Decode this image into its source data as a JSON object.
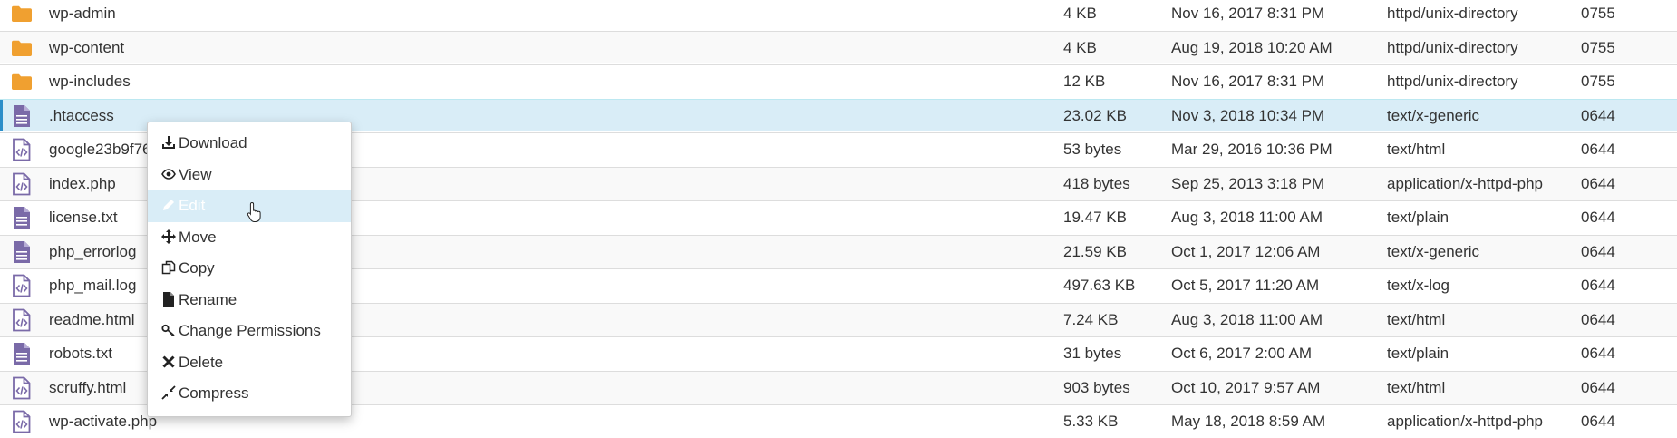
{
  "files": [
    {
      "name": "wp-admin",
      "size": "4 KB",
      "date": "Nov 16, 2017 8:31 PM",
      "type": "httpd/unix-directory",
      "perms": "0755",
      "icon": "folder-icon"
    },
    {
      "name": "wp-content",
      "size": "4 KB",
      "date": "Aug 19, 2018 10:20 AM",
      "type": "httpd/unix-directory",
      "perms": "0755",
      "icon": "folder-icon"
    },
    {
      "name": "wp-includes",
      "size": "12 KB",
      "date": "Nov 16, 2017 8:31 PM",
      "type": "httpd/unix-directory",
      "perms": "0755",
      "icon": "folder-icon"
    },
    {
      "name": ".htaccess",
      "size": "23.02 KB",
      "date": "Nov 3, 2018 10:34 PM",
      "type": "text/x-generic",
      "perms": "0644",
      "icon": "text-file-icon",
      "selected": true
    },
    {
      "name": "google23b9f76",
      "size": "53 bytes",
      "date": "Mar 29, 2016 10:36 PM",
      "type": "text/html",
      "perms": "0644",
      "icon": "code-file-icon"
    },
    {
      "name": "index.php",
      "size": "418 bytes",
      "date": "Sep 25, 2013 3:18 PM",
      "type": "application/x-httpd-php",
      "perms": "0644",
      "icon": "code-file-icon"
    },
    {
      "name": "license.txt",
      "size": "19.47 KB",
      "date": "Aug 3, 2018 11:00 AM",
      "type": "text/plain",
      "perms": "0644",
      "icon": "text-file-icon"
    },
    {
      "name": "php_errorlog",
      "size": "21.59 KB",
      "date": "Oct 1, 2017 12:06 AM",
      "type": "text/x-generic",
      "perms": "0644",
      "icon": "text-file-icon"
    },
    {
      "name": "php_mail.log",
      "size": "497.63 KB",
      "date": "Oct 5, 2017 11:20 AM",
      "type": "text/x-log",
      "perms": "0644",
      "icon": "code-file-icon"
    },
    {
      "name": "readme.html",
      "size": "7.24 KB",
      "date": "Aug 3, 2018 11:00 AM",
      "type": "text/html",
      "perms": "0644",
      "icon": "code-file-icon"
    },
    {
      "name": "robots.txt",
      "size": "31 bytes",
      "date": "Oct 6, 2017 2:00 AM",
      "type": "text/plain",
      "perms": "0644",
      "icon": "text-file-icon"
    },
    {
      "name": "scruffy.html",
      "size": "903 bytes",
      "date": "Oct 10, 2017 9:57 AM",
      "type": "text/html",
      "perms": "0644",
      "icon": "code-file-icon"
    },
    {
      "name": "wp-activate.php",
      "size": "5.33 KB",
      "date": "May 18, 2018 8:59 AM",
      "type": "application/x-httpd-php",
      "perms": "0644",
      "icon": "code-file-icon"
    }
  ],
  "context_menu": {
    "items": [
      {
        "label": "Download",
        "icon": "download-icon"
      },
      {
        "label": "View",
        "icon": "eye-icon"
      },
      {
        "label": "Edit",
        "icon": "pencil-icon",
        "active": true
      },
      {
        "label": "Move",
        "icon": "move-arrows-icon"
      },
      {
        "label": "Copy",
        "icon": "copy-icon"
      },
      {
        "label": "Rename",
        "icon": "file-icon"
      },
      {
        "label": "Change Permissions",
        "icon": "key-icon"
      },
      {
        "label": "Delete",
        "icon": "x-icon"
      },
      {
        "label": "Compress",
        "icon": "compress-icon"
      }
    ]
  },
  "colors": {
    "folder": "#f0a030",
    "file": "#7a6aa8",
    "selected_row": "#d9edf7",
    "alt_row": "#f9f9f9"
  }
}
